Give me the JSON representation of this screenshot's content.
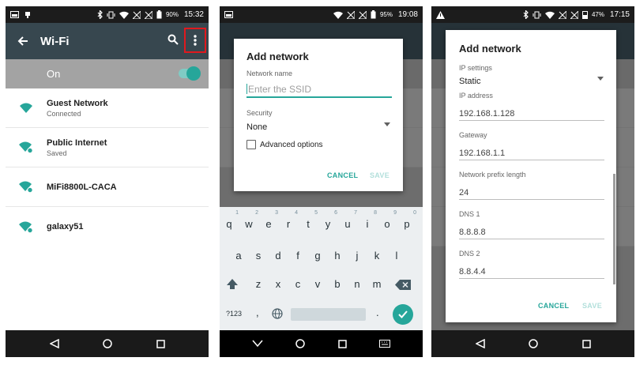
{
  "screen1": {
    "status": {
      "battery": "90%",
      "time": "15:32"
    },
    "toolbar": {
      "title": "Wi-Fi"
    },
    "wifi_toggle_label": "On",
    "networks": [
      {
        "name": "Guest Network",
        "status": "Connected"
      },
      {
        "name": "Public Internet",
        "status": "Saved"
      },
      {
        "name": "MiFi8800L-CACA",
        "status": ""
      },
      {
        "name": "galaxy51",
        "status": ""
      }
    ],
    "colors": {
      "toolbar": "#37474f",
      "highlight_box": "#e0191e",
      "accent": "#26a69a"
    }
  },
  "screen2": {
    "status": {
      "battery": "95%",
      "time": "19:08"
    },
    "dialog": {
      "title": "Add network",
      "network_name_label": "Network name",
      "ssid_placeholder": "Enter the SSID",
      "security_label": "Security",
      "security_value": "None",
      "advanced_options": "Advanced options",
      "cancel": "CANCEL",
      "save": "SAVE"
    },
    "keyboard": {
      "row1": [
        "q",
        "w",
        "e",
        "r",
        "t",
        "y",
        "u",
        "i",
        "o",
        "p"
      ],
      "row1_hints": [
        "1",
        "2",
        "3",
        "4",
        "5",
        "6",
        "7",
        "8",
        "9",
        "0"
      ],
      "row2": [
        "a",
        "s",
        "d",
        "f",
        "g",
        "h",
        "j",
        "k",
        "l"
      ],
      "row3": [
        "z",
        "x",
        "c",
        "v",
        "b",
        "n",
        "m"
      ],
      "symbols_key": "?123",
      "comma": ",",
      "period": "."
    }
  },
  "screen3": {
    "status": {
      "battery": "47%",
      "time": "17:15"
    },
    "dialog": {
      "title": "Add network",
      "fields": [
        {
          "label": "IP settings",
          "value": "Static"
        },
        {
          "label": "IP address",
          "value": "192.168.1.128"
        },
        {
          "label": "Gateway",
          "value": "192.168.1.1"
        },
        {
          "label": "Network prefix length",
          "value": "24"
        },
        {
          "label": "DNS 1",
          "value": "8.8.8.8"
        },
        {
          "label": "DNS 2",
          "value": "8.8.4.4"
        }
      ],
      "cancel": "CANCEL",
      "save": "SAVE"
    }
  }
}
